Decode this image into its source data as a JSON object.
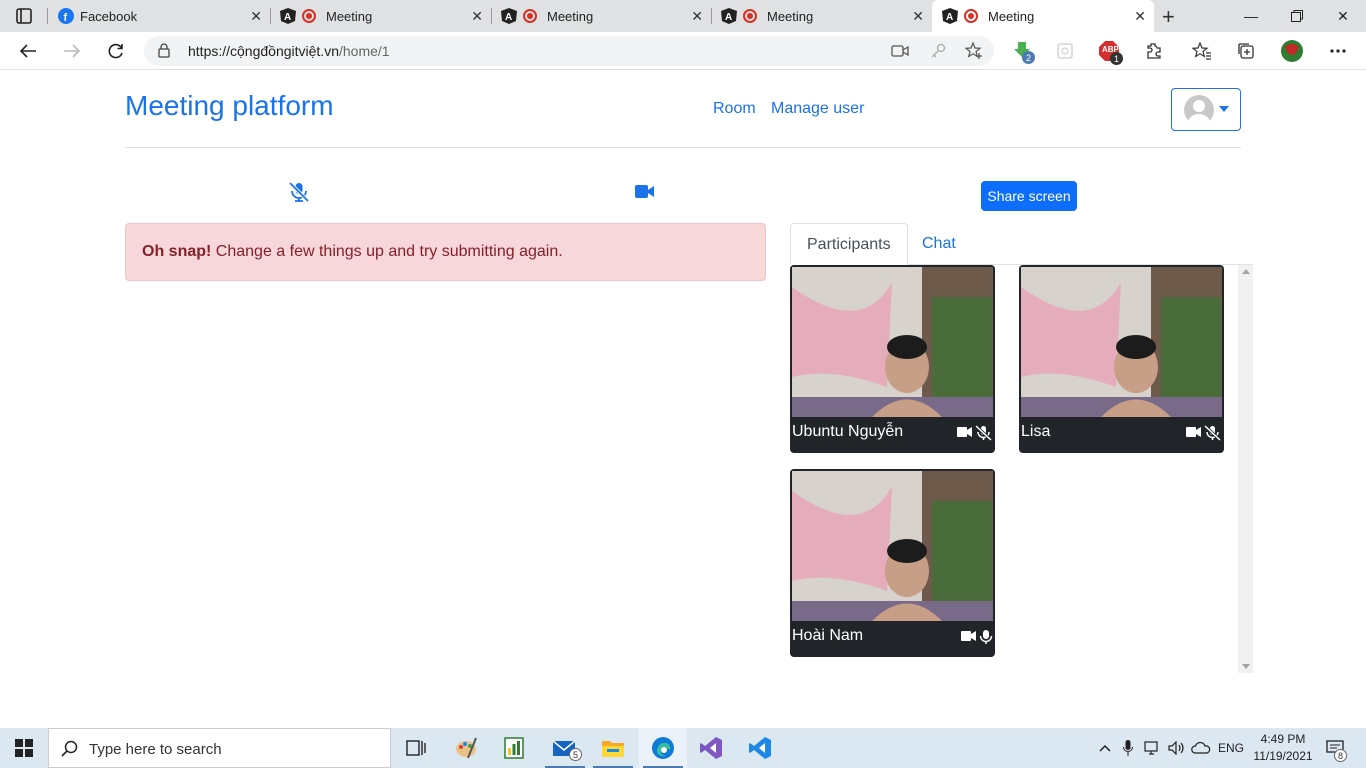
{
  "browser": {
    "tabs": [
      {
        "title": "Facebook",
        "icon": "facebook-icon"
      },
      {
        "title": "Meeting",
        "icon": "angular-icon",
        "recording": true
      },
      {
        "title": "Meeting",
        "icon": "angular-icon",
        "recording": true
      },
      {
        "title": "Meeting",
        "icon": "angular-icon",
        "recording": true
      },
      {
        "title": "Meeting",
        "icon": "angular-icon",
        "recording": true,
        "active": true
      }
    ],
    "url_host": "https://cộngđồngitviệt.vn",
    "url_path": "/home/1",
    "extensions": {
      "ext1_badge": "2",
      "adblock_label": "ABP",
      "adblock_badge": "1"
    }
  },
  "page": {
    "brand": "Meeting platform",
    "nav": {
      "room": "Room",
      "manage_user": "Manage user"
    },
    "controls": {
      "share_screen": "Share screen"
    },
    "alert": {
      "strong": "Oh snap!",
      "text": " Change a few things up and try submitting again."
    },
    "tabs": {
      "participants": "Participants",
      "chat": "Chat"
    },
    "participants": [
      {
        "name": "Ubuntu Nguyễn",
        "video": "on",
        "mic": "muted"
      },
      {
        "name": "Lisa",
        "video": "on",
        "mic": "muted"
      },
      {
        "name": "Hoài Nam",
        "video": "on",
        "mic": "on"
      }
    ]
  },
  "taskbar": {
    "search_placeholder": "Type here to search",
    "mail_badge": "5",
    "lang": "ENG",
    "time": "4:49 PM",
    "date": "11/19/2021",
    "notif_badge": "8"
  },
  "colors": {
    "primary": "#0d6efd",
    "link": "#1a73e8",
    "alert_bg": "#f8d7da",
    "alert_text": "#842029",
    "card_bg": "#212529"
  }
}
